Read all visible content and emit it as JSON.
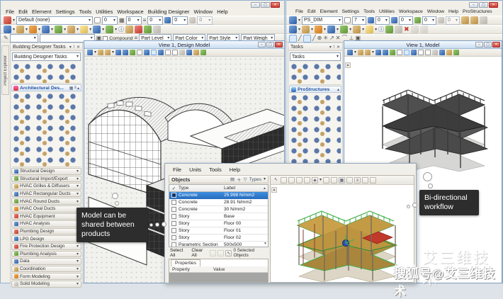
{
  "left_app": {
    "menu": [
      "File",
      "Edit",
      "Element",
      "Settings",
      "Tools",
      "Utilities",
      "Workspace",
      "Building Designer",
      "Window",
      "Help"
    ],
    "attributes": {
      "template": "Default (none)",
      "color": "0",
      "style": "0",
      "weight": "0",
      "transparency": "0",
      "priority": "0"
    },
    "selection_bar": {
      "compound": "Compound",
      "buttons": [
        "Part Level",
        "Part Color",
        "Part Style",
        "Part Weigh"
      ]
    },
    "explorer_tab": "Project Explorer",
    "tasks": {
      "title": "Building Designer Tasks",
      "selector": "Building Designer Tasks",
      "section": "Architectural Des...",
      "sections": [
        "Structural Design",
        "Structural Import/Export",
        "HVAC Grilles & Diffusers",
        "HVAC Rectangular Ducts",
        "HVAC Round Ducts",
        "HVAC Oval Ducts",
        "HVAC Equipment",
        "HVAC Analysis",
        "Plumbing Design",
        "LPG Design",
        "Fire Protection Design",
        "Plumbing Analysis",
        "Data",
        "Coordination",
        "Form Modeling",
        "Solid Modeling"
      ]
    },
    "view": {
      "title": "View 1, Design Model"
    }
  },
  "right_app": {
    "menu": [
      "File",
      "Edit",
      "Element",
      "Settings",
      "Tools",
      "Utilities",
      "Workspace",
      "Window",
      "Help",
      "ProStructures"
    ],
    "attributes": {
      "template": "PS_DIM",
      "v1": "7",
      "v2": "0",
      "v3": "0",
      "v4": "0",
      "v5": "0"
    },
    "tasks": {
      "title": "Tasks",
      "selector": "Tasks",
      "section": "ProStructures"
    },
    "view": {
      "title": "View 1, Model"
    }
  },
  "sync": {
    "menu": [
      "File",
      "Units",
      "Tools",
      "Help"
    ],
    "objects": {
      "title": "Objects",
      "filter": "Types",
      "columns": [
        "Type",
        "Label"
      ],
      "rows": [
        {
          "type": "Concrete",
          "label": "25.998 N/mm2"
        },
        {
          "type": "Concrete",
          "label": "28.91 N/mm2"
        },
        {
          "type": "Concrete",
          "label": "30 N/mm2"
        },
        {
          "type": "Story",
          "label": "Base"
        },
        {
          "type": "Story",
          "label": "Floor 00"
        },
        {
          "type": "Story",
          "label": "Floor 01"
        },
        {
          "type": "Story",
          "label": "Floor 02"
        },
        {
          "type": "Parametric Section",
          "label": "500x500"
        }
      ],
      "select_all": "Select All",
      "clear_all": "Clear All",
      "status": "0 Selected Objects"
    },
    "properties": {
      "tab": "Properties",
      "col_property": "Property",
      "col_value": "Value"
    }
  },
  "callouts": {
    "left": "Model can be shared between products",
    "right": "Bi-directional workflow"
  },
  "watermark": {
    "brand": "艾三维技术",
    "handle": "搜狐号@艾三维技术"
  },
  "colors": {
    "selection_row": "#2e7fd6",
    "callout_bg": "#2d2d2d",
    "beam_green": "#3fae49",
    "slab_tan": "#bd9440",
    "struct_gray": "#3c3c3c"
  }
}
